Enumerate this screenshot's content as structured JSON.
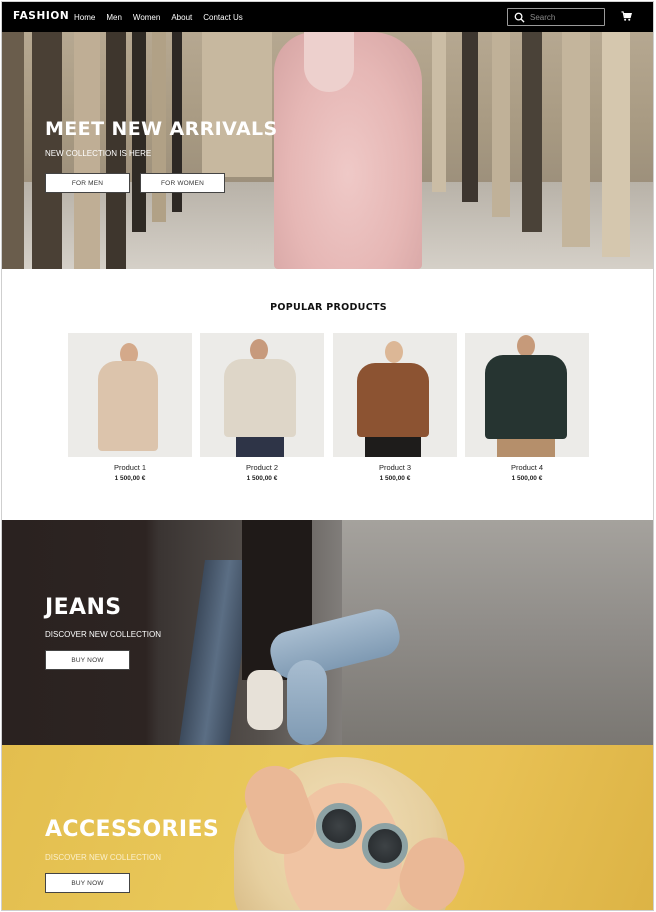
{
  "nav": {
    "logo": "FASHION",
    "links": [
      "Home",
      "Men",
      "Women",
      "About",
      "Contact Us"
    ],
    "search_placeholder": "Search"
  },
  "hero": {
    "title": "MEET NEW ARRIVALS",
    "subtitle": "NEW COLLECTION IS HERE",
    "btn_men": "FOR MEN",
    "btn_women": "FOR WOMEN"
  },
  "popular": {
    "title": "POPULAR PRODUCTS",
    "products": [
      {
        "name": "Product 1",
        "price": "1 500,00 €"
      },
      {
        "name": "Product 2",
        "price": "1 500,00 €"
      },
      {
        "name": "Product 3",
        "price": "1 500,00 €"
      },
      {
        "name": "Product 4",
        "price": "1 500,00 €"
      }
    ]
  },
  "jeans": {
    "title": "JEANS",
    "subtitle": "DISCOVER NEW COLLECTION",
    "button": "BUY NOW"
  },
  "accessories": {
    "title": "ACCESSORIES",
    "subtitle": "DISCOVER NEW COLLECTION",
    "button": "BUY NOW"
  },
  "colors": {
    "nav_bg": "#000000",
    "hero_stone": "#a89a82",
    "accessories_yellow": "#e6c253"
  }
}
